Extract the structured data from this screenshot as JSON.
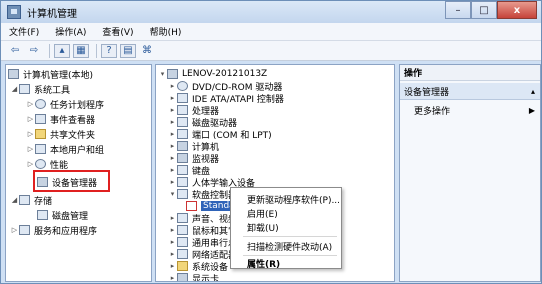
{
  "window": {
    "title": "计算机管理",
    "buttons": {
      "minimize": "–",
      "maximize": "□",
      "close": "x"
    }
  },
  "menu": [
    "文件(F)",
    "操作(A)",
    "查看(V)",
    "帮助(H)"
  ],
  "left_tree": [
    {
      "label": "计算机管理(本地)"
    },
    {
      "label": "系统工具"
    },
    {
      "label": "任务计划程序"
    },
    {
      "label": "事件查看器"
    },
    {
      "label": "共享文件夹"
    },
    {
      "label": "本地用户和组"
    },
    {
      "label": "性能"
    },
    {
      "label": "设备管理器"
    },
    {
      "label": "存储"
    },
    {
      "label": "磁盘管理"
    },
    {
      "label": "服务和应用程序"
    }
  ],
  "device_tree": [
    {
      "label": "LENOV-20121013Z"
    },
    {
      "label": "DVD/CD-ROM 驱动器"
    },
    {
      "label": "IDE ATA/ATAPI 控制器"
    },
    {
      "label": "处理器"
    },
    {
      "label": "磁盘驱动器"
    },
    {
      "label": "端口 (COM 和 LPT)"
    },
    {
      "label": "计算机"
    },
    {
      "label": "监视器"
    },
    {
      "label": "键盘"
    },
    {
      "label": "人体学输入设备"
    },
    {
      "label": "软盘控制器"
    },
    {
      "label": "Standa"
    },
    {
      "label": "声音、视频"
    },
    {
      "label": "鼠标和其它"
    },
    {
      "label": "通用串行总"
    },
    {
      "label": "网络适配器"
    },
    {
      "label": "系统设备"
    },
    {
      "label": "显示卡"
    }
  ],
  "context_menu": [
    "更新驱动程序软件(P)...",
    "启用(E)",
    "卸载(U)",
    "扫描检测硬件改动(A)",
    "属性(R)"
  ],
  "actions_pane": {
    "header": "操作",
    "item": "设备管理器",
    "more": "更多操作"
  }
}
